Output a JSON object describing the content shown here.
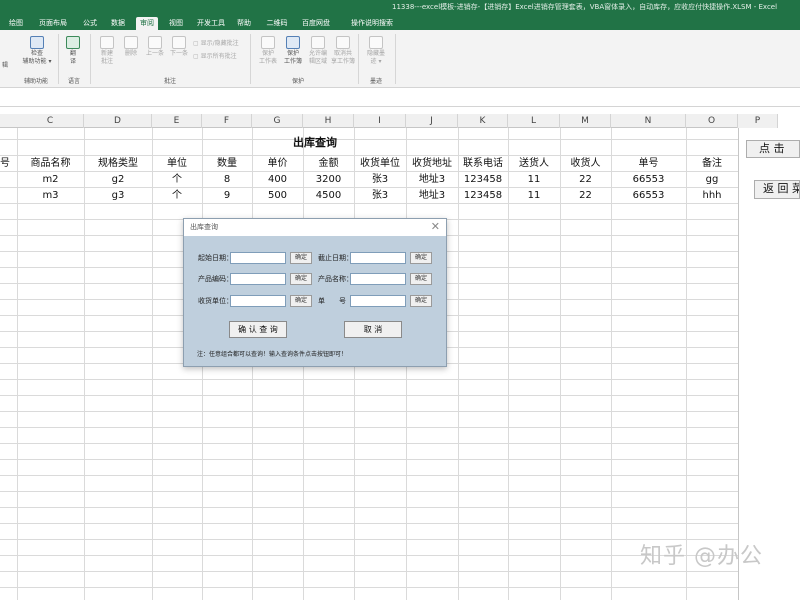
{
  "window": {
    "title": "11338---excel模板-进销存-【进销存】Excel进销存管理套表，VBA窗体录入，自动库存，应收应付快捷操作.XLSM  -  Excel"
  },
  "ribbon_tabs": [
    {
      "label": "绘图",
      "active": false
    },
    {
      "label": "页面布局",
      "active": false
    },
    {
      "label": "公式",
      "active": false
    },
    {
      "label": "数据",
      "active": false
    },
    {
      "label": "审阅",
      "active": true
    },
    {
      "label": "视图",
      "active": false
    },
    {
      "label": "开发工具",
      "active": false
    },
    {
      "label": "帮助",
      "active": false
    },
    {
      "label": "二维码",
      "active": false
    },
    {
      "label": "百度网盘",
      "active": false
    },
    {
      "label": "操作说明搜索",
      "active": false
    }
  ],
  "ribbon": {
    "fragment_label": "辑",
    "fragment_label_2": "功能",
    "check_button": "检查\n辅助功能 ▾",
    "translate_button": "翻\n译",
    "comment_buttons": [
      "新建\n批注",
      "删除",
      "上一条",
      "下一条"
    ],
    "show_hide_comment": "显示/隐藏批注",
    "show_all_comments": "显示所有批注",
    "protect_buttons": [
      "保护\n工作表",
      "保护\n工作簿",
      "允许编\n辑区域",
      "取消共\n享工作簿"
    ],
    "ink_button": "隐藏墨\n迹 ▾",
    "groups": {
      "accessibility": "辅助功能",
      "language": "语言",
      "comments": "批注",
      "protect": "保护",
      "ink": "墨迹"
    }
  },
  "columns": [
    "B",
    "C",
    "D",
    "E",
    "F",
    "G",
    "H",
    "I",
    "J",
    "K",
    "L",
    "M",
    "N",
    "O",
    "P"
  ],
  "sheet_title": "出库查询",
  "table": {
    "headers": [
      "号",
      "商品名称",
      "规格类型",
      "单位",
      "数量",
      "单价",
      "金额",
      "收货单位",
      "收货地址",
      "联系电话",
      "送货人",
      "收货人",
      "单号",
      "备注"
    ],
    "rows": [
      [
        "",
        "m2",
        "g2",
        "个",
        "8",
        "400",
        "3200",
        "张3",
        "地址3",
        "123458",
        "11",
        "22",
        "66553",
        "gg"
      ],
      [
        "",
        "m3",
        "g3",
        "个",
        "9",
        "500",
        "4500",
        "张3",
        "地址3",
        "123458",
        "11",
        "22",
        "66553",
        "hhh"
      ]
    ]
  },
  "side_buttons": {
    "query": "点 击",
    "back": "返 回 菜"
  },
  "dialog": {
    "title": "出库查询",
    "close": "✕",
    "fields": [
      {
        "label": "起始日期：",
        "value": "",
        "button": "确定"
      },
      {
        "label": "截止日期：",
        "value": "",
        "button": "确定"
      },
      {
        "label": "产品编码：",
        "value": "",
        "button": "确定"
      },
      {
        "label": "产品名称：",
        "value": "",
        "button": "确定"
      },
      {
        "label": "收货单位：",
        "value": "",
        "button": "确定"
      },
      {
        "label": "单　　号",
        "value": "",
        "button": "确定"
      }
    ],
    "confirm_button": "确 认 查 询",
    "cancel_button": "取  消",
    "note": "注：任意组合都可以查询！输入查询条件点击按钮即可！"
  },
  "watermark": "知乎 @办公",
  "colors": {
    "excel_green": "#217346",
    "dialog_bg": "#bfcfdd",
    "grid_line": "#dadada"
  }
}
